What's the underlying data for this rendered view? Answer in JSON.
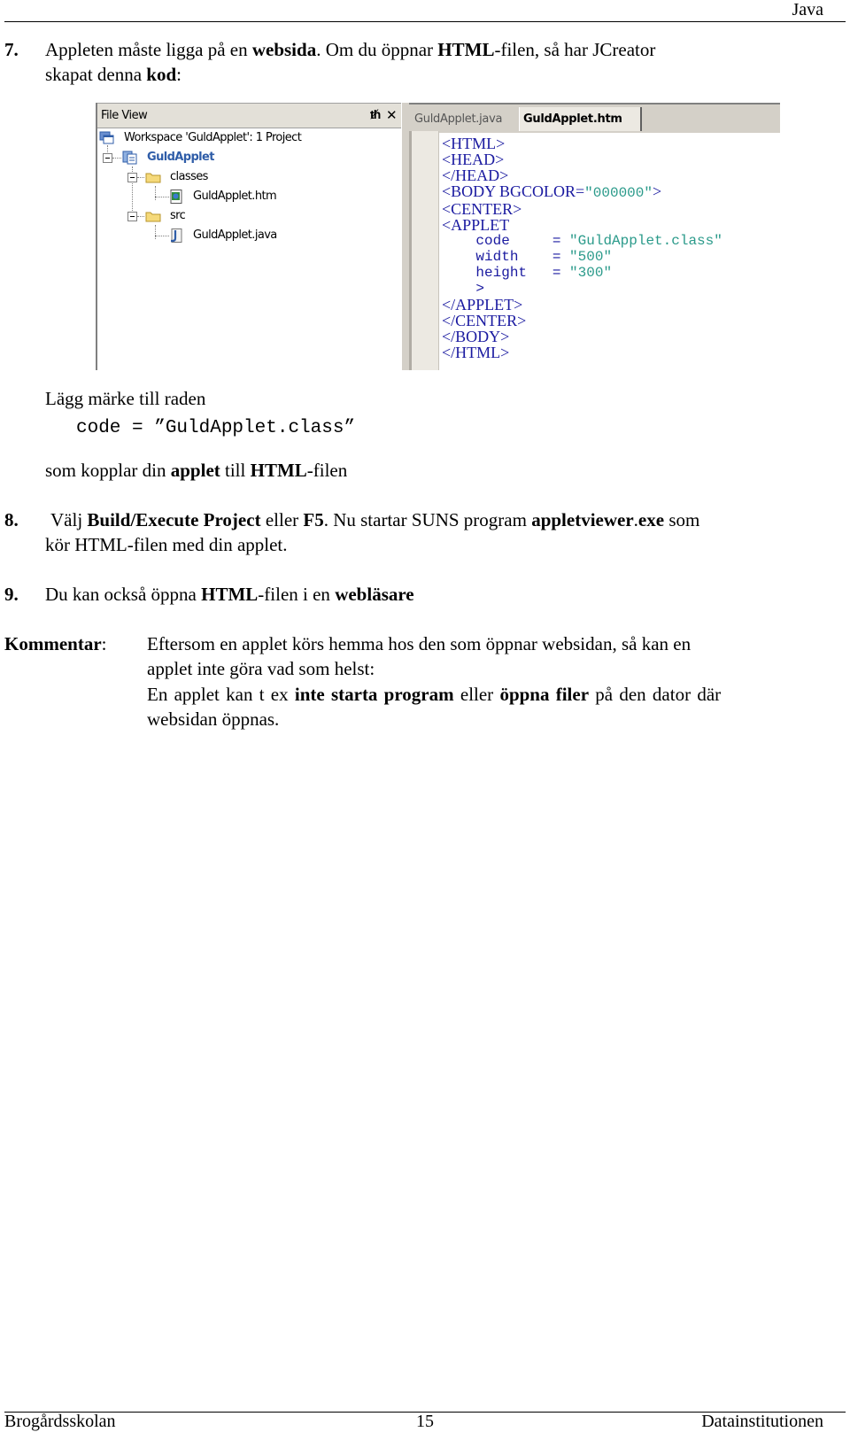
{
  "header": {
    "title": "Java"
  },
  "step7": {
    "number": "7.",
    "line1": {
      "t1": "Appleten måste ligga på en ",
      "b1": "websida",
      "t2": ". Om du öppnar ",
      "b2": "HTML",
      "t3": "-filen, så har JCreator"
    },
    "line2": {
      "t1": "skapat denna ",
      "b1": "kod",
      "t2": ":"
    }
  },
  "ide": {
    "file_view": {
      "title": "File View",
      "pin_icon": "pin-icon",
      "close_icon": "close-icon",
      "tree": [
        {
          "label": "Workspace 'GuldApplet': 1 Project",
          "icon": "workspace-icon"
        },
        {
          "label": "GuldApplet",
          "icon": "project-icon",
          "bold": true,
          "color": "#2f5da8"
        },
        {
          "label": "classes",
          "icon": "folder-icon"
        },
        {
          "label": "GuldApplet.htm",
          "icon": "html-file-icon"
        },
        {
          "label": "src",
          "icon": "folder-icon"
        },
        {
          "label": "GuldApplet.java",
          "icon": "java-file-icon"
        }
      ]
    },
    "editor": {
      "tabs": [
        {
          "label": "GuldApplet.java",
          "active": false
        },
        {
          "label": "GuldApplet.htm",
          "active": true
        }
      ],
      "code": {
        "l1": "<HTML>",
        "l2": "<HEAD>",
        "l3": "</HEAD>",
        "l4_tag": "<BODY BGCOLOR=",
        "l4_val": "\"000000\"",
        "l4_end": ">",
        "l5": "<CENTER>",
        "l6": "<APPLET",
        "l7_attr": "    code     = ",
        "l7_val": "\"GuldApplet.class\"",
        "l8_attr": "    width    = ",
        "l8_val": "\"500\"",
        "l9_attr": "    height   = ",
        "l9_val": "\"300\"",
        "l10": "    >",
        "l11": "</APPLET>",
        "l12": "</CENTER>",
        "l13": "</BODY>",
        "l14": "</HTML>"
      }
    },
    "colors": {
      "tag": "#1a1aa0",
      "string": "#2a9a8a",
      "chrome": "#d4d0c8"
    }
  },
  "note": {
    "intro": "Lägg märke till raden",
    "code_line": "code = ”GuldApplet.class”",
    "after": {
      "t1": "som kopplar din ",
      "b1": "applet",
      "t2": " till ",
      "b2": "HTML",
      "t3": "-filen"
    }
  },
  "step8": {
    "number": "8.",
    "line1": {
      "t1": "Välj ",
      "b1": "Build/Execute Project",
      "t2": " eller ",
      "b2": "F5",
      "t3": ". Nu startar SUNS program ",
      "b3": "appletviewer",
      "t4": ".",
      "b4": "exe",
      "t5": " som"
    },
    "line2": "kör HTML-filen med din applet."
  },
  "step9": {
    "number": "9.",
    "t1": "Du kan också öppna ",
    "b1": "HTML",
    "t2": "-filen i en ",
    "b2": "webläsare"
  },
  "comment": {
    "label": "Kommentar",
    "colon": ":",
    "line1": "Eftersom en applet körs hemma hos den som öppnar websidan, så kan en",
    "line2": "applet inte göra vad som helst:",
    "line3": {
      "t1": "En applet kan t ex ",
      "b1": "inte starta program",
      "t2": " eller ",
      "b2": "öppna filer",
      "t3": " på den dator där"
    },
    "line4": "websidan öppnas."
  },
  "footer": {
    "left": "Brogårdsskolan",
    "center": "15",
    "right": "Datainstitutionen"
  }
}
